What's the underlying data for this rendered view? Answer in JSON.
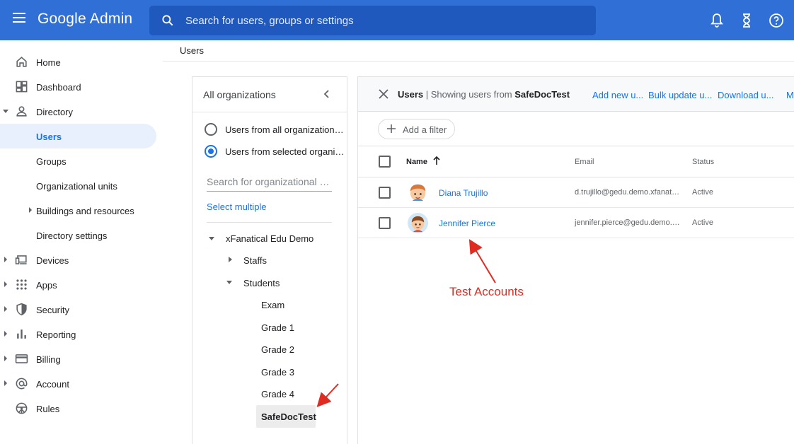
{
  "app": {
    "brand": "Google Admin",
    "search_placeholder": "Search for users, groups or settings"
  },
  "top_icons": [
    "bell-icon",
    "hourglass-icon",
    "help-icon"
  ],
  "breadcrumb": "Users",
  "sidebar": {
    "items": [
      {
        "label": "Home",
        "icon": "home-icon"
      },
      {
        "label": "Dashboard",
        "icon": "dashboard-icon"
      },
      {
        "label": "Directory",
        "icon": "person-icon"
      },
      {
        "label": "Users"
      },
      {
        "label": "Groups"
      },
      {
        "label": "Organizational units"
      },
      {
        "label": "Buildings and resources"
      },
      {
        "label": "Directory settings"
      },
      {
        "label": "Devices",
        "icon": "devices-icon"
      },
      {
        "label": "Apps",
        "icon": "apps-grid-icon"
      },
      {
        "label": "Security",
        "icon": "shield-icon"
      },
      {
        "label": "Reporting",
        "icon": "bar-chart-icon"
      },
      {
        "label": "Billing",
        "icon": "credit-card-icon"
      },
      {
        "label": "Account",
        "icon": "at-sign-icon"
      },
      {
        "label": "Rules",
        "icon": "steering-wheel-icon"
      }
    ]
  },
  "org_panel": {
    "title": "All organizations",
    "radio_all": "Users from all organizational units",
    "radio_selected": "Users from selected organizational units",
    "search_placeholder": "Search for organizational units",
    "select_multiple": "Select multiple",
    "tree": {
      "root": "xFanatical Edu Demo",
      "staffs": "Staffs",
      "students": "Students",
      "exam": "Exam",
      "grade1": "Grade 1",
      "grade2": "Grade 2",
      "grade3": "Grade 3",
      "grade4": "Grade 4",
      "safedoctest": "SafeDocTest"
    }
  },
  "users_panel": {
    "title": "Users",
    "subtitle_prefix": "| Showing users from",
    "subtitle_org": "SafeDocTest",
    "links": [
      "Add new u...",
      "Bulk update u...",
      "Download u...",
      "Mo"
    ],
    "filter_label": "Add a filter",
    "columns": {
      "name": "Name",
      "email": "Email",
      "status": "Status"
    },
    "rows": [
      {
        "name": "Diana Trujillo",
        "email": "d.trujillo@gedu.demo.xfanatical.com",
        "status": "Active"
      },
      {
        "name": "Jennifer Pierce",
        "email": "jennifer.pierce@gedu.demo.xfanatical.com",
        "status": "Active"
      }
    ]
  },
  "annotation": {
    "text": "Test Accounts",
    "color": "#e02b20"
  },
  "colors": {
    "topbar": "#2f6fd6",
    "accent": "#1a73e8",
    "active_bg": "#e8f0fe"
  }
}
